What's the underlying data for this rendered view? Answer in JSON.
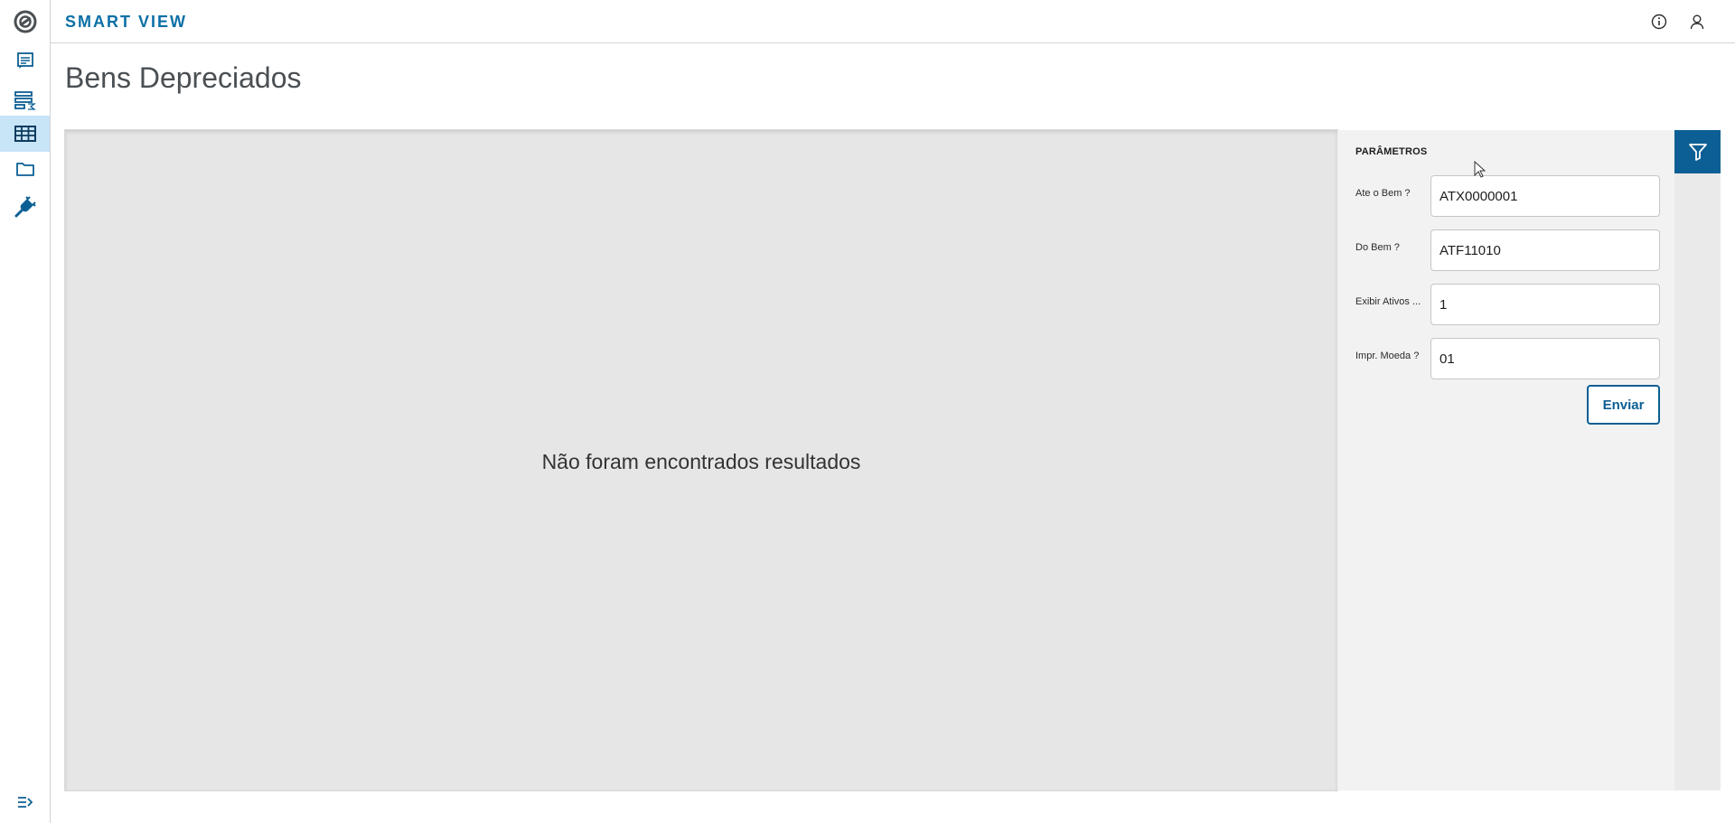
{
  "header": {
    "brand": "SMART VIEW",
    "info_icon": "info-icon",
    "user_icon": "user-icon"
  },
  "sidebar": {
    "items": [
      {
        "icon": "report-icon",
        "active": false
      },
      {
        "icon": "analysis-icon",
        "active": false
      },
      {
        "icon": "table-icon",
        "active": true
      },
      {
        "icon": "folder-icon",
        "active": false
      },
      {
        "icon": "plug-icon",
        "active": false
      }
    ],
    "collapse_icon": "expand-menu-icon"
  },
  "page": {
    "title": "Bens Depreciados"
  },
  "results": {
    "empty_message": "Não foram encontrados resultados"
  },
  "parameters": {
    "title": "PARÂMETROS",
    "fields": [
      {
        "label": "Ate o Bem ?",
        "value": "ATX0000001"
      },
      {
        "label": "Do Bem ?",
        "value": "ATF11010"
      },
      {
        "label": "Exibir Ativos ...",
        "value": "1"
      },
      {
        "label": "Impr. Moeda ?",
        "value": "01"
      }
    ],
    "submit_label": "Enviar"
  },
  "colors": {
    "primary": "#0c5f94",
    "brand_text": "#0c6fa6",
    "active_nav": "#c8e4f7",
    "results_bg": "#e6e6e6"
  }
}
